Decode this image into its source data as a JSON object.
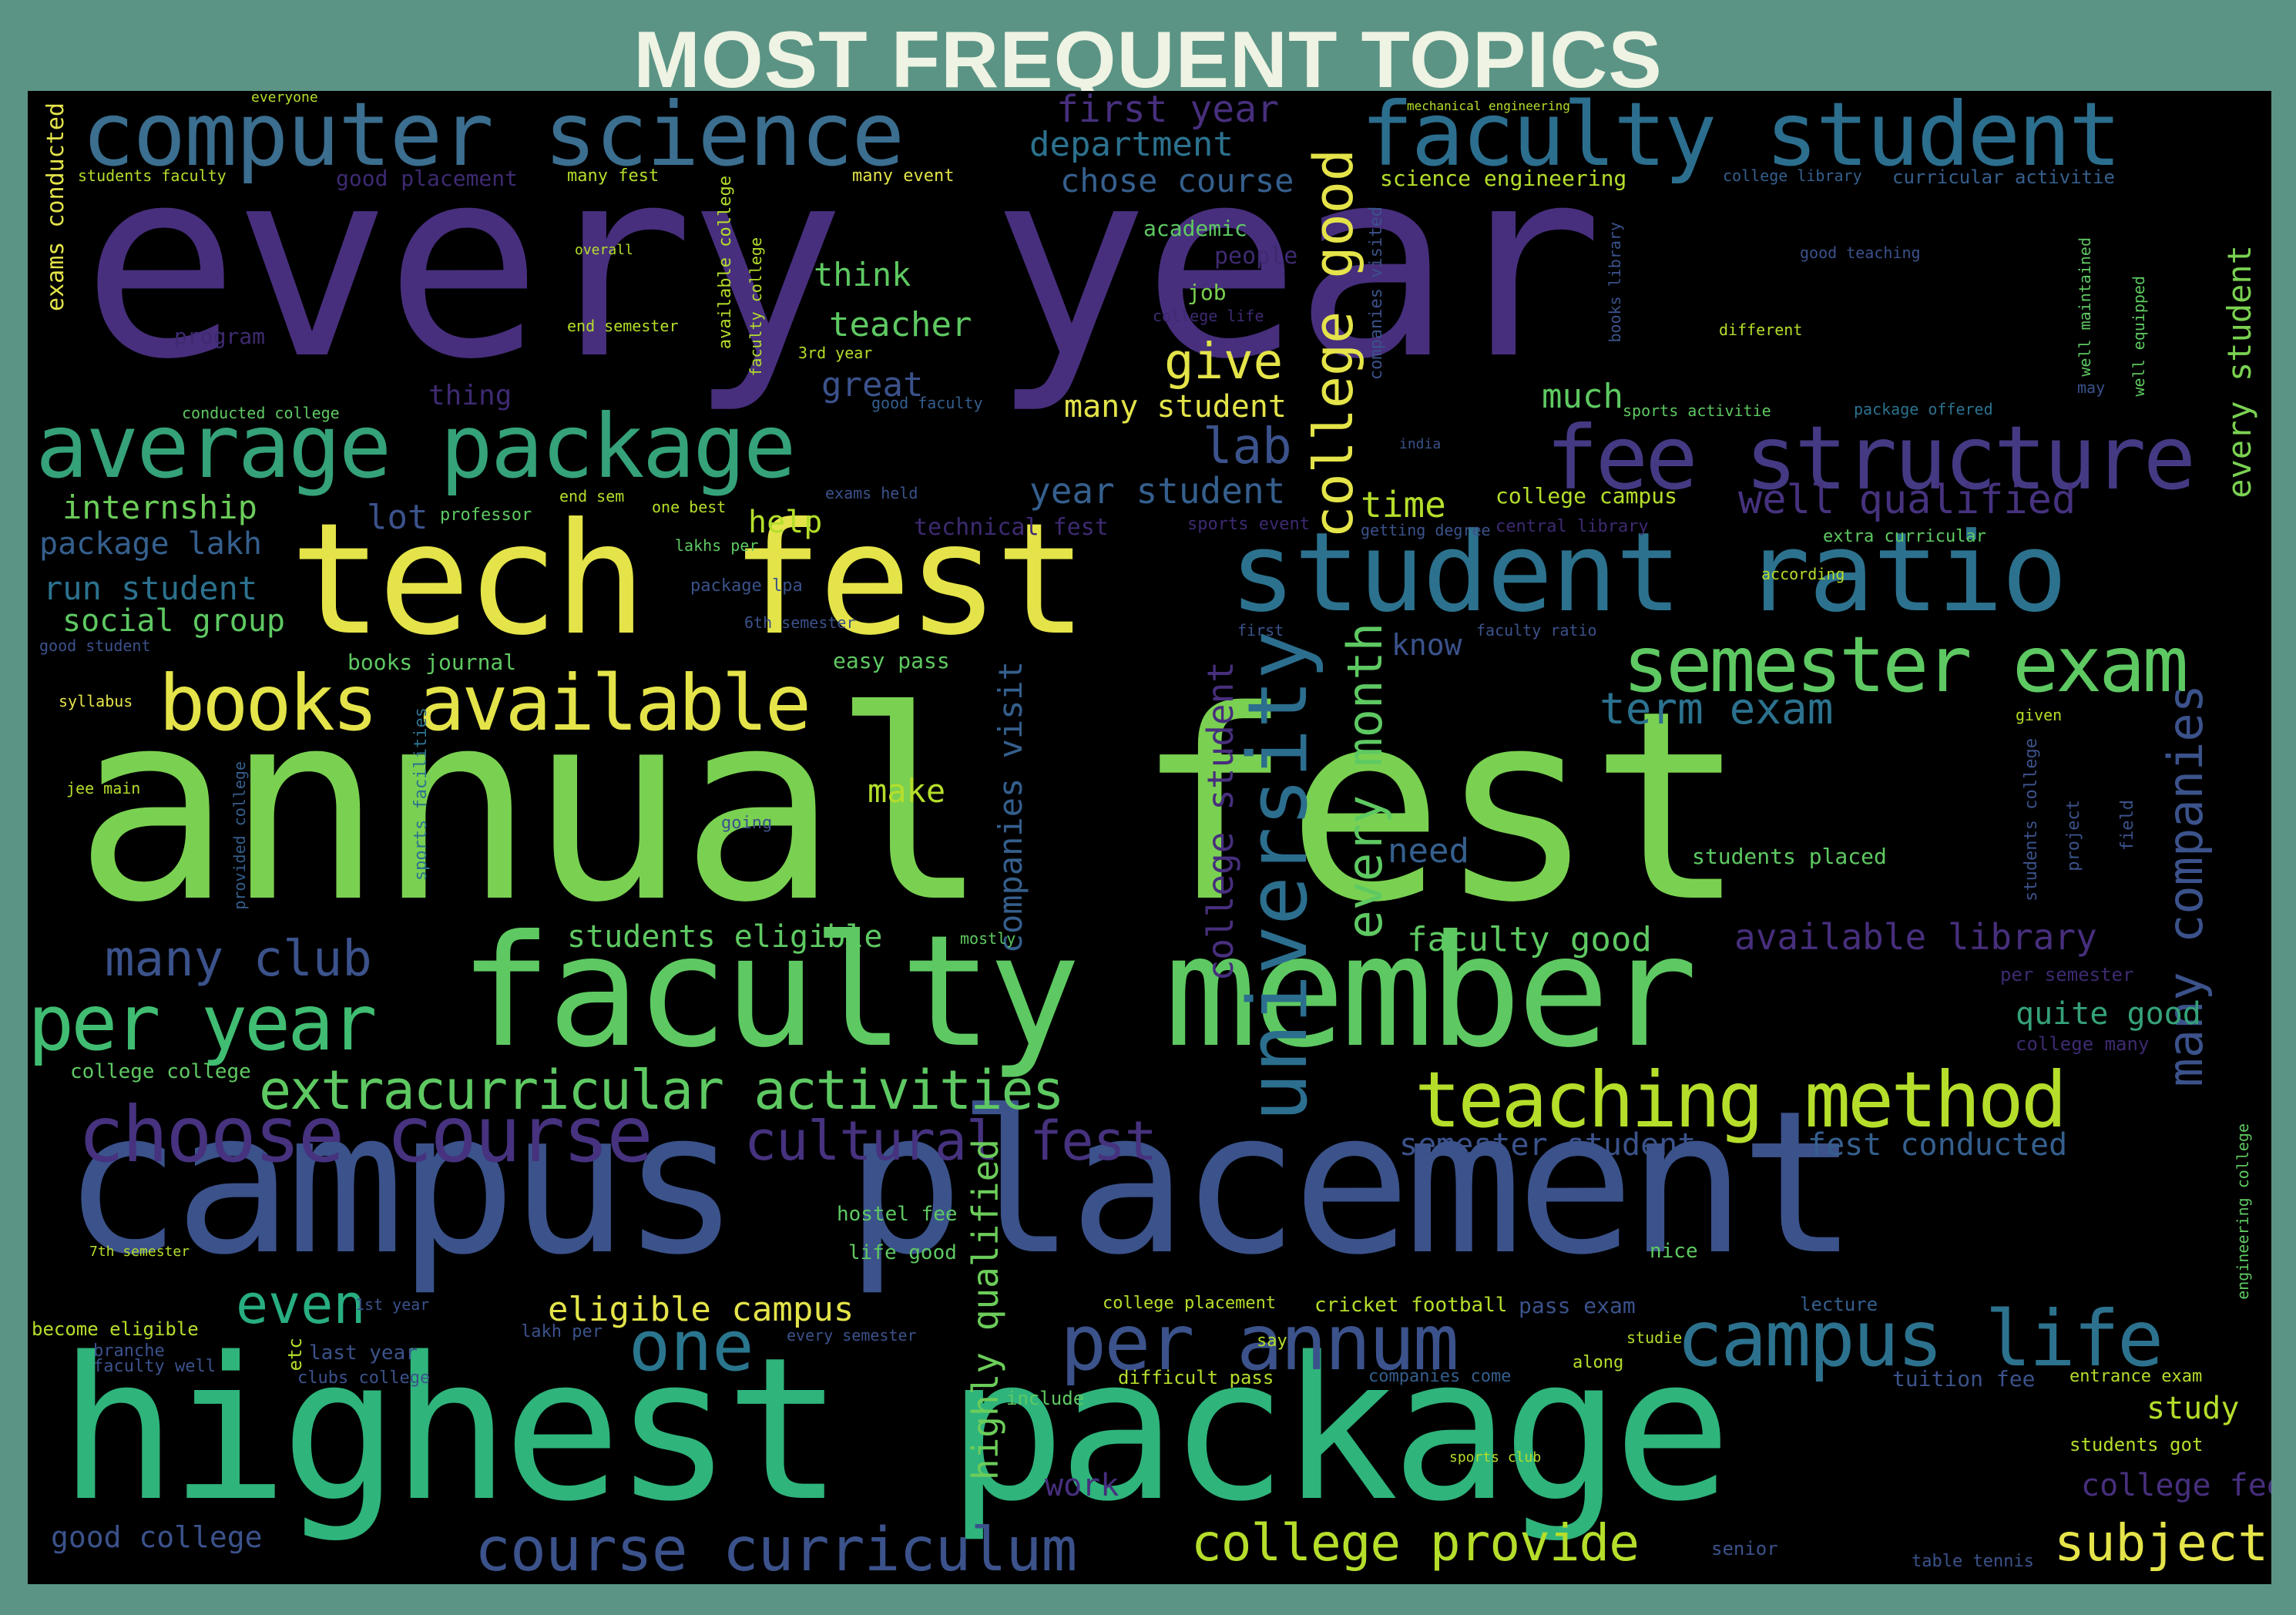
{
  "title": "MOST FREQUENT TOPICS",
  "palette": {
    "purple": "#472f7d",
    "violet": "#46327e",
    "blue": "#3b528b",
    "slate": "#2c728e",
    "teal": "#28ae80",
    "seagreen": "#5ec962",
    "green": "#7ad151",
    "lime": "#b5de2b",
    "yellow": "#e4e44a",
    "darkviolet": "#3e2a71"
  },
  "words": [
    {
      "text": "every year",
      "color": "#472f7d"
    },
    {
      "text": "annual fest",
      "color": "#7ad151"
    },
    {
      "text": "campus placement",
      "color": "#3b528b"
    },
    {
      "text": "highest package",
      "color": "#2fb47c"
    },
    {
      "text": "faculty member",
      "color": "#5ec962"
    },
    {
      "text": "tech fest",
      "color": "#e4e44a"
    },
    {
      "text": "student ratio",
      "color": "#2c728e"
    },
    {
      "text": "computer science",
      "color": "#3b6e8f"
    },
    {
      "text": "faculty student",
      "color": "#2c6e8e"
    },
    {
      "text": "average package",
      "color": "#35a279"
    },
    {
      "text": "fee structure",
      "color": "#443a83"
    },
    {
      "text": "semester exam",
      "color": "#5ec962"
    },
    {
      "text": "books available",
      "color": "#e4e44a"
    },
    {
      "text": "choose course",
      "color": "#46327e"
    },
    {
      "text": "per year",
      "color": "#40bd72"
    },
    {
      "text": "teaching method",
      "color": "#b5de2b"
    },
    {
      "text": "extracurricular activities",
      "color": "#5ec962"
    },
    {
      "text": "campus life",
      "color": "#2c728e"
    },
    {
      "text": "per annum",
      "color": "#3b528b"
    },
    {
      "text": "one",
      "color": "#2a768e"
    },
    {
      "text": "even",
      "color": "#28ae80"
    },
    {
      "text": "course curriculum",
      "color": "#3b528b"
    },
    {
      "text": "college provide",
      "color": "#b5de2b"
    },
    {
      "text": "subject",
      "color": "#e4e44a"
    },
    {
      "text": "cultural fest",
      "color": "#46327e"
    },
    {
      "text": "many club",
      "color": "#3b528b"
    },
    {
      "text": "university",
      "color": "#2c6e8e"
    },
    {
      "text": "college good",
      "color": "#e4e44a"
    },
    {
      "text": "every month",
      "color": "#5ec962"
    },
    {
      "text": "college student",
      "color": "#472f7d"
    },
    {
      "text": "companies visit",
      "color": "#355f8d"
    },
    {
      "text": "highly qualified",
      "color": "#6ccd5a"
    },
    {
      "text": "many companies",
      "color": "#3b528b"
    },
    {
      "text": "every student",
      "color": "#7ad151"
    },
    {
      "text": "department",
      "color": "#2c728e"
    },
    {
      "text": "chose course",
      "color": "#355f8d"
    },
    {
      "text": "first year",
      "color": "#472f7d"
    },
    {
      "text": "give",
      "color": "#e4e44a"
    },
    {
      "text": "lab",
      "color": "#3b528b"
    },
    {
      "text": "time",
      "color": "#b5de2b"
    },
    {
      "text": "well qualified",
      "color": "#46327e"
    },
    {
      "text": "year student",
      "color": "#355f8d"
    },
    {
      "text": "internship",
      "color": "#6ccd5a"
    },
    {
      "text": "lot",
      "color": "#3b528b"
    },
    {
      "text": "package lakh",
      "color": "#355f8d"
    },
    {
      "text": "run student",
      "color": "#2c728e"
    },
    {
      "text": "social group",
      "color": "#5ec962"
    },
    {
      "text": "many student",
      "color": "#e4e44a"
    },
    {
      "text": "great",
      "color": "#3b528b"
    },
    {
      "text": "teacher",
      "color": "#5ec962"
    },
    {
      "text": "think",
      "color": "#5ec962"
    },
    {
      "text": "much",
      "color": "#5ec962"
    },
    {
      "text": "help",
      "color": "#b5de2b"
    },
    {
      "text": "term exam",
      "color": "#2c728e"
    },
    {
      "text": "make",
      "color": "#b5de2b"
    },
    {
      "text": "need",
      "color": "#355f8d"
    },
    {
      "text": "know",
      "color": "#3b528b"
    },
    {
      "text": "faculty good",
      "color": "#5ec962"
    },
    {
      "text": "available library",
      "color": "#472f7d"
    },
    {
      "text": "quite good",
      "color": "#35a279"
    },
    {
      "text": "students eligible",
      "color": "#5ec962"
    },
    {
      "text": "eligible campus",
      "color": "#e4e44a"
    },
    {
      "text": "semester student",
      "color": "#3b528b"
    },
    {
      "text": "fest conducted",
      "color": "#355f8d"
    },
    {
      "text": "study",
      "color": "#b5de2b"
    },
    {
      "text": "college fee",
      "color": "#472f7d"
    },
    {
      "text": "good college",
      "color": "#3b528b"
    },
    {
      "text": "work",
      "color": "#472f7d"
    },
    {
      "text": "exams conducted",
      "color": "#e4e44a"
    },
    {
      "text": "academic",
      "color": "#5ec962"
    },
    {
      "text": "science engineering",
      "color": "#b5de2b"
    },
    {
      "text": "good placement",
      "color": "#3e2a71"
    },
    {
      "text": "many fest",
      "color": "#b5de2b"
    },
    {
      "text": "many event",
      "color": "#e4e44a"
    },
    {
      "text": "people",
      "color": "#3e2a71"
    },
    {
      "text": "job",
      "color": "#7ad151"
    },
    {
      "text": "college life",
      "color": "#3e2a71"
    },
    {
      "text": "program",
      "color": "#3e2a71"
    },
    {
      "text": "thing",
      "color": "#3e2a71"
    },
    {
      "text": "professor",
      "color": "#5ec962"
    },
    {
      "text": "end sem",
      "color": "#b5de2b"
    },
    {
      "text": "one best",
      "color": "#b5de2b"
    },
    {
      "text": "exams held",
      "color": "#3b528b"
    },
    {
      "text": "technical fest",
      "color": "#3e2a71"
    },
    {
      "text": "sports event",
      "color": "#3e2a71"
    },
    {
      "text": "central library",
      "color": "#3e2a71"
    },
    {
      "text": "college campus",
      "color": "#b5de2b"
    },
    {
      "text": "extra curricular",
      "color": "#5ec962"
    },
    {
      "text": "books journal",
      "color": "#5ec962"
    },
    {
      "text": "easy pass",
      "color": "#5ec962"
    },
    {
      "text": "syllabus",
      "color": "#e4e44a"
    },
    {
      "text": "jee main",
      "color": "#b5de2b"
    },
    {
      "text": "students placed",
      "color": "#5ec962"
    },
    {
      "text": "sports facilities",
      "color": "#2c728e"
    },
    {
      "text": "college college",
      "color": "#5ec962"
    },
    {
      "text": "become eligible",
      "color": "#b5de2b"
    },
    {
      "text": "faculty well",
      "color": "#3b528b"
    },
    {
      "text": "last year",
      "color": "#3b528b"
    },
    {
      "text": "cricket football",
      "color": "#b5de2b"
    },
    {
      "text": "pass exam",
      "color": "#3b528b"
    },
    {
      "text": "lecture",
      "color": "#355f8d"
    },
    {
      "text": "difficult pass",
      "color": "#b5de2b"
    },
    {
      "text": "companies come",
      "color": "#355f8d"
    },
    {
      "text": "tuition fee",
      "color": "#3b528b"
    },
    {
      "text": "entrance exam",
      "color": "#b5de2b"
    },
    {
      "text": "students got",
      "color": "#b5de2b"
    },
    {
      "text": "table tennis",
      "color": "#3b528b"
    },
    {
      "text": "senior",
      "color": "#3b528b"
    },
    {
      "text": "hostel fee",
      "color": "#5ec962"
    },
    {
      "text": "life good",
      "color": "#5ec962"
    },
    {
      "text": "include",
      "color": "#5ec962"
    },
    {
      "text": "along",
      "color": "#b5de2b"
    },
    {
      "text": "nice",
      "color": "#5ec962"
    },
    {
      "text": "studie",
      "color": "#b5de2b"
    },
    {
      "text": "per semester",
      "color": "#3e2a71"
    },
    {
      "text": "college many",
      "color": "#3e2a71"
    },
    {
      "text": "different",
      "color": "#b5de2b"
    },
    {
      "text": "good teaching",
      "color": "#3b528b"
    },
    {
      "text": "package offered",
      "color": "#2c728e"
    },
    {
      "text": "sports activitie",
      "color": "#5ec962"
    },
    {
      "text": "curricular activitie",
      "color": "#355f8d"
    },
    {
      "text": "college library",
      "color": "#355f8d"
    },
    {
      "text": "students faculty",
      "color": "#b5de2b"
    },
    {
      "text": "conducted college",
      "color": "#5ec962"
    },
    {
      "text": "good faculty",
      "color": "#355f8d"
    },
    {
      "text": "end semester",
      "color": "#b5de2b"
    },
    {
      "text": "3rd year",
      "color": "#b5de2b"
    },
    {
      "text": "well equipped",
      "color": "#5ec962"
    },
    {
      "text": "well maintained",
      "color": "#5ec962"
    },
    {
      "text": "students college",
      "color": "#3b528b"
    },
    {
      "text": "engineering college",
      "color": "#5ec962"
    },
    {
      "text": "project",
      "color": "#3b528b"
    },
    {
      "text": "field",
      "color": "#3b528b"
    },
    {
      "text": "given",
      "color": "#b5de2b"
    },
    {
      "text": "according",
      "color": "#b5de2b"
    },
    {
      "text": "faculty ratio",
      "color": "#3b528b"
    },
    {
      "text": "first",
      "color": "#3b528b"
    },
    {
      "text": "getting degree",
      "color": "#3b528b"
    },
    {
      "text": "6th semester",
      "color": "#3b528b"
    },
    {
      "text": "package lpa",
      "color": "#3b528b"
    },
    {
      "text": "lakhs per",
      "color": "#5ec962"
    },
    {
      "text": "good student",
      "color": "#3b528b"
    },
    {
      "text": "going",
      "color": "#3b528b"
    },
    {
      "text": "mostly",
      "color": "#5ec962"
    },
    {
      "text": "provided college",
      "color": "#355f8d"
    },
    {
      "text": "available college",
      "color": "#b5de2b"
    },
    {
      "text": "faculty college",
      "color": "#b5de2b"
    },
    {
      "text": "companies visited",
      "color": "#3b528b"
    },
    {
      "text": "books library",
      "color": "#3b528b"
    },
    {
      "text": "college placement",
      "color": "#b5de2b"
    },
    {
      "text": "clubs college",
      "color": "#3b528b"
    },
    {
      "text": "every semester",
      "color": "#3b528b"
    },
    {
      "text": "lakh per",
      "color": "#3b528b"
    },
    {
      "text": "1st year",
      "color": "#3b528b"
    },
    {
      "text": "branche",
      "color": "#3b528b"
    },
    {
      "text": "7th semester",
      "color": "#b5de2b"
    },
    {
      "text": "etc",
      "color": "#b5de2b"
    },
    {
      "text": "everyone",
      "color": "#b5de2b"
    },
    {
      "text": "overall",
      "color": "#b5de2b"
    },
    {
      "text": "mechanical engineering",
      "color": "#b5de2b"
    },
    {
      "text": "may",
      "color": "#3b528b"
    },
    {
      "text": "india",
      "color": "#3b528b"
    },
    {
      "text": "sports club",
      "color": "#b5de2b"
    },
    {
      "text": "say",
      "color": "#b5de2b"
    }
  ]
}
